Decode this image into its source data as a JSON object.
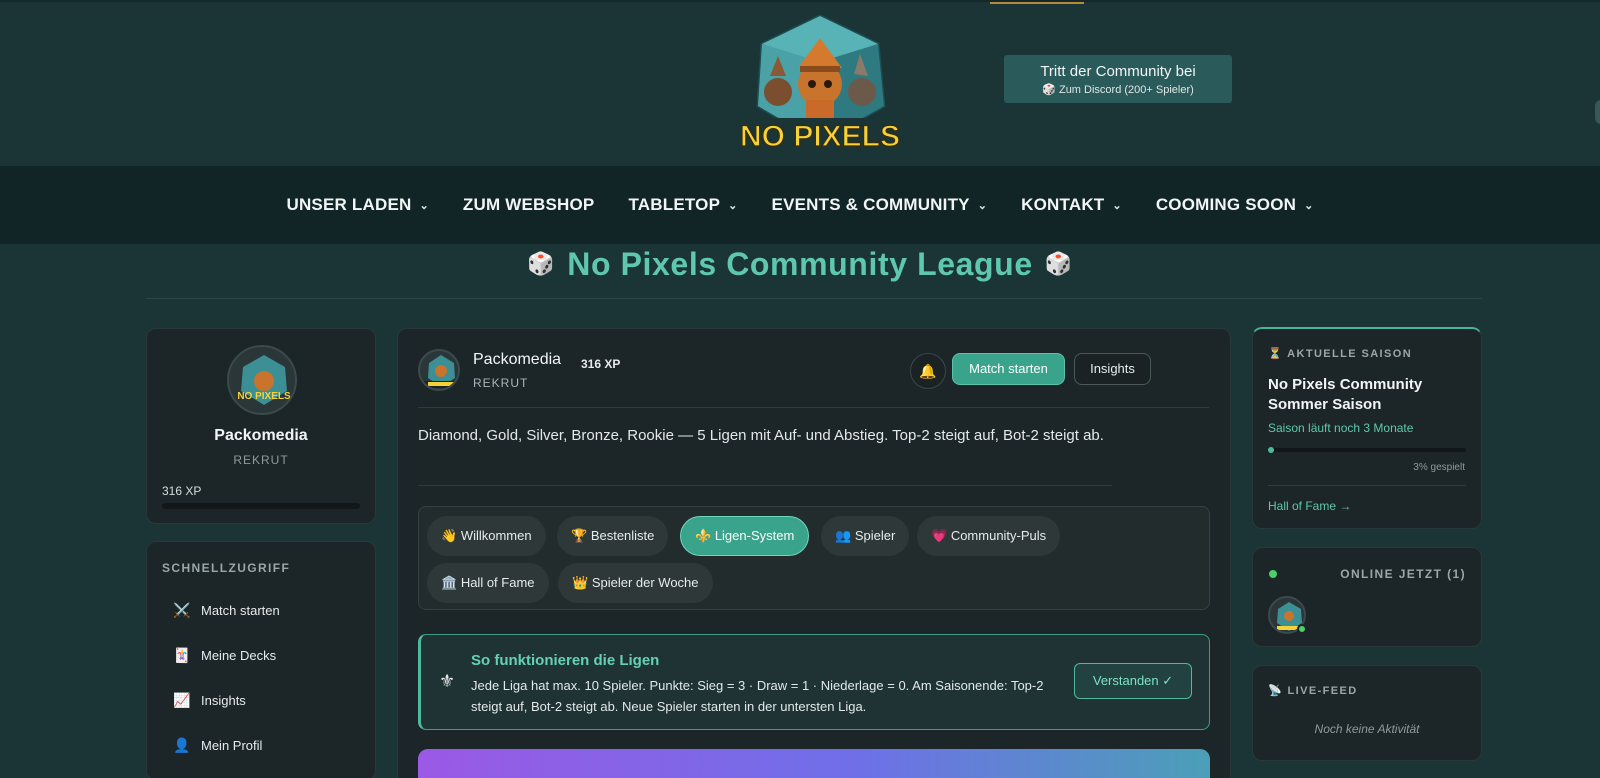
{
  "header": {
    "logo_text": "NO PIXELS",
    "discord": {
      "title": "Tritt der Community bei",
      "subtitle": "🎲 Zum Discord (200+ Spieler)"
    }
  },
  "nav": {
    "items": [
      {
        "label": "UNSER LADEN",
        "dropdown": true
      },
      {
        "label": "ZUM WEBSHOP",
        "dropdown": false
      },
      {
        "label": "TABLETOP",
        "dropdown": true
      },
      {
        "label": "EVENTS & COMMUNITY",
        "dropdown": true
      },
      {
        "label": "KONTAKT",
        "dropdown": true
      },
      {
        "label": "COOMING SOON",
        "dropdown": true
      }
    ]
  },
  "page": {
    "title": "No Pixels Community League",
    "dice": "🎲"
  },
  "profile": {
    "name": "Packomedia",
    "rank": "REKRUT",
    "xp_label": "316 XP",
    "xp_progress": 0
  },
  "quick_access": {
    "title": "SCHNELLZUGRIFF",
    "items": [
      {
        "icon": "⚔️",
        "label": "Match starten"
      },
      {
        "icon": "🃏",
        "label": "Meine Decks"
      },
      {
        "icon": "📈",
        "label": "Insights"
      },
      {
        "icon": "👤",
        "label": "Mein Profil"
      }
    ]
  },
  "main": {
    "user": {
      "name": "Packomedia",
      "rank": "REKRUT",
      "xp": "316 XP"
    },
    "bell_icon": "🔔",
    "match_button": "Match starten",
    "insights_button": "Insights",
    "description": "Diamond, Gold, Silver, Bronze, Rookie — 5 Ligen mit Auf- und Abstieg. Top-2 steigt auf, Bot-2 steigt ab.",
    "tabs": [
      {
        "icon": "👋",
        "label": "Willkommen"
      },
      {
        "icon": "🏆",
        "label": "Bestenliste"
      },
      {
        "icon": "⚜️",
        "label": "Ligen-System",
        "active": true
      },
      {
        "icon": "👥",
        "label": "Spieler"
      },
      {
        "icon": "💗",
        "label": "Community-Puls"
      },
      {
        "icon": "🏛️",
        "label": "Hall of Fame"
      },
      {
        "icon": "👑",
        "label": "Spieler der Woche"
      }
    ],
    "info": {
      "icon": "⚜",
      "title": "So funktionieren die Ligen",
      "text": "Jede Liga hat max. 10 Spieler. Punkte: Sieg = 3 · Draw = 1 · Niederlage = 0. Am Saisonende: Top-2 steigt auf, Bot-2 steigt ab. Neue Spieler starten in der untersten Liga.",
      "button": "Verstanden ✓"
    }
  },
  "season": {
    "head": "⏳ AKTUELLE SAISON",
    "name": "No Pixels Community Sommer Saison",
    "remaining": "Saison läuft noch 3 Monate",
    "progress_label": "3% gespielt",
    "progress": 0.03,
    "link": "Hall of Fame →"
  },
  "online": {
    "head": "ONLINE JETZT (1)"
  },
  "feed": {
    "head": "📡 LIVE-FEED",
    "empty": "Noch keine Aktivität"
  },
  "colors": {
    "accent": "#3aa38c",
    "accent_text": "#5fc7ae",
    "header_bg": "#1b3536",
    "nav_bg": "#122526",
    "card_bg": "#1c2628",
    "discord_bg": "#2a5a5a"
  }
}
